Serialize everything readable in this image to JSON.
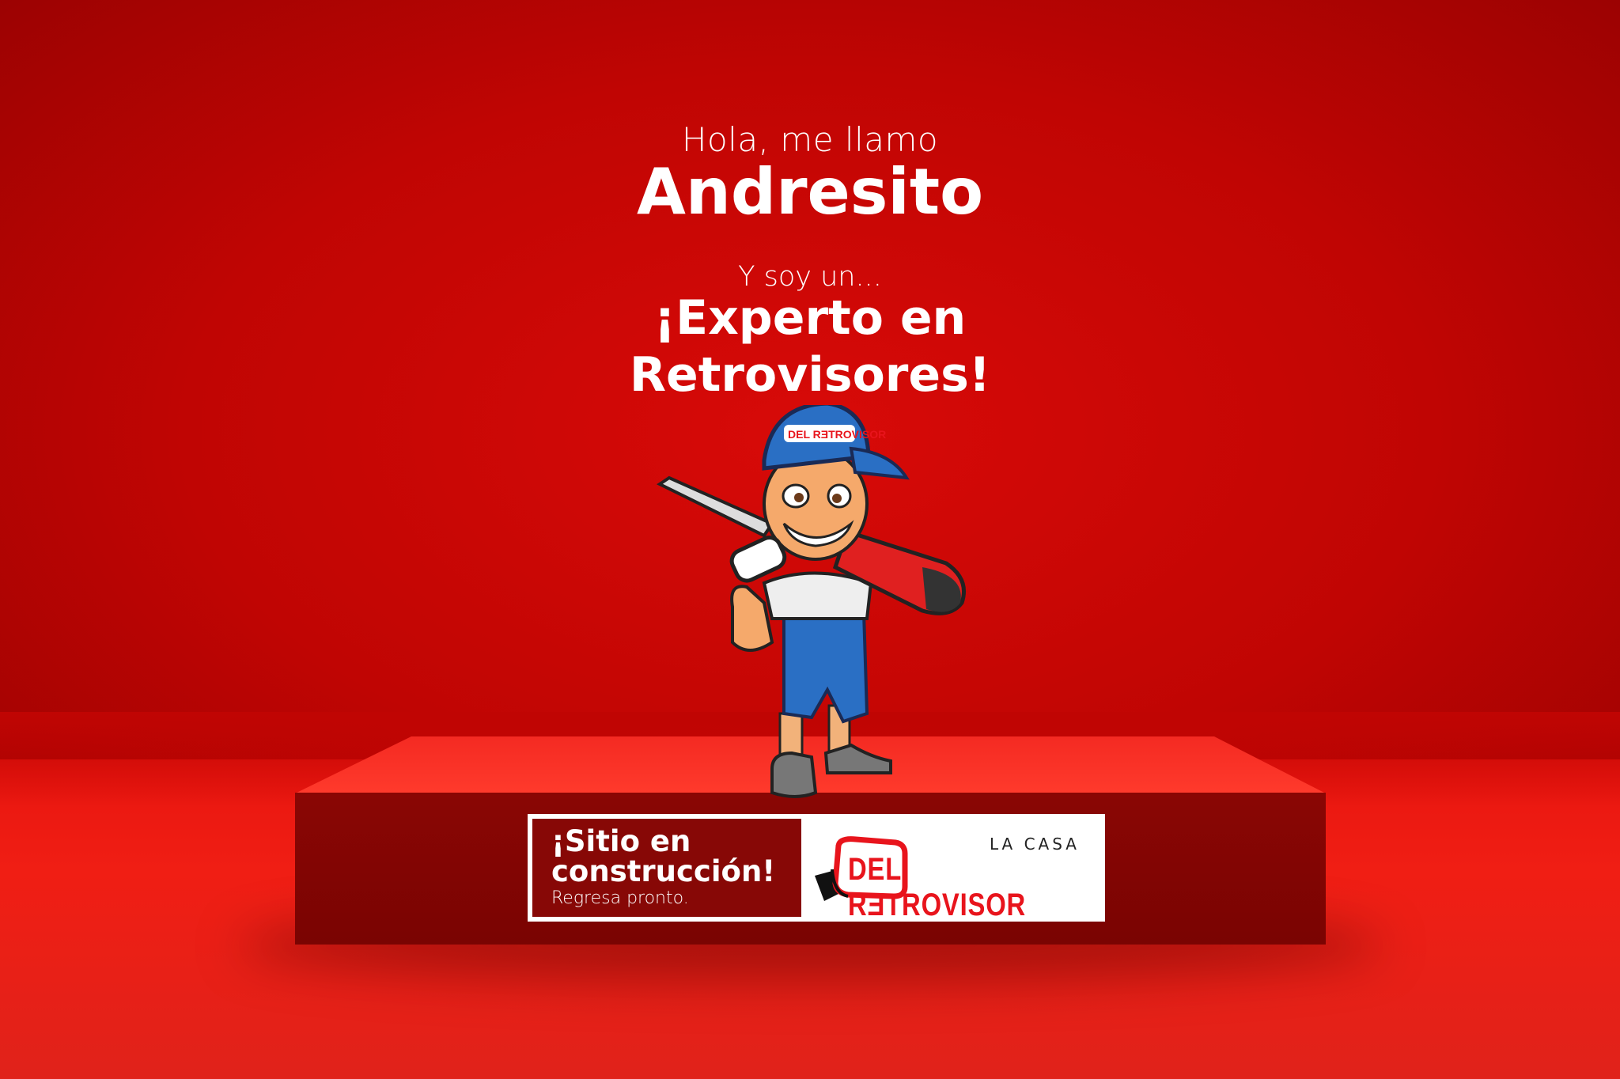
{
  "intro": {
    "greeting": "Hola, me llamo",
    "name": "Andresito",
    "lead": "Y soy un...",
    "title_line1": "¡Experto en",
    "title_line2": "Retrovisores!"
  },
  "banner": {
    "headline_line1": "¡Sitio en",
    "headline_line2": "construcción!",
    "subtext": "Regresa pronto."
  },
  "logo": {
    "top_text": "LA CASA",
    "main_text": "DEL RƎTROVISOR"
  },
  "mascot": {
    "name": "mascot-andresito"
  },
  "colors": {
    "background": "#c00503",
    "accent": "#e8141c",
    "banner_dark": "#870806"
  }
}
